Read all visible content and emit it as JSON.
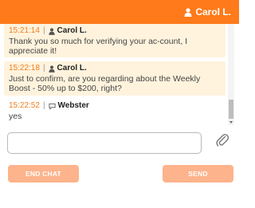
{
  "header": {
    "user_name": "Carol L.",
    "user_icon": "user-icon"
  },
  "messages": [
    {
      "time": "15:21:14",
      "separator": "|",
      "author": "Carol L.",
      "author_icon": "user-icon",
      "text": "Thank you so much for verifying your ac-count, I appreciate it!"
    },
    {
      "time": "15:22:18",
      "separator": "|",
      "author": "Carol L.",
      "author_icon": "user-icon",
      "text": "Just to confirm, are you regarding about the Weekly Boost - 50% up to $200, right?"
    },
    {
      "time": "15:22:52",
      "separator": "|",
      "author": "Webster",
      "author_icon": "chat-bubble-icon",
      "text": "yes"
    }
  ],
  "composer": {
    "input_value": "",
    "input_placeholder": "",
    "attach_icon": "paperclip-icon"
  },
  "actions": {
    "end_chat_label": "END CHAT",
    "send_label": "SEND"
  },
  "colors": {
    "header_bg": "#ff7a1a",
    "timestamp": "#f07e1e",
    "agent_message_bg": "#fff3dd",
    "button_bg": "#fdb38b"
  }
}
